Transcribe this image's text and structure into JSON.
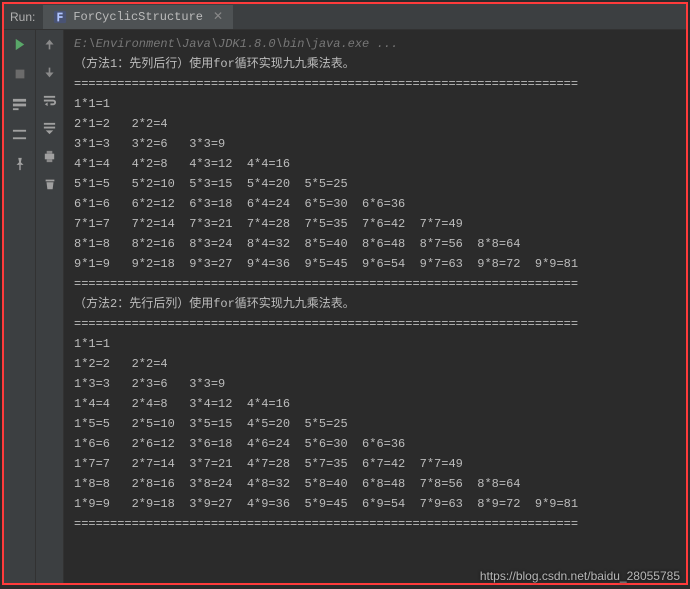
{
  "header": {
    "run_label": "Run:",
    "tab_name": "ForCyclicStructure"
  },
  "command": "E:\\Environment\\Java\\JDK1.8.0\\bin\\java.exe ...",
  "console_lines": [
    "（方法1：先列后行）使用for循环实现九九乘法表。",
    "======================================================================",
    "1*1=1",
    "2*1=2   2*2=4",
    "3*1=3   3*2=6   3*3=9",
    "4*1=4   4*2=8   4*3=12  4*4=16",
    "5*1=5   5*2=10  5*3=15  5*4=20  5*5=25",
    "6*1=6   6*2=12  6*3=18  6*4=24  6*5=30  6*6=36",
    "7*1=7   7*2=14  7*3=21  7*4=28  7*5=35  7*6=42  7*7=49",
    "8*1=8   8*2=16  8*3=24  8*4=32  8*5=40  8*6=48  8*7=56  8*8=64",
    "9*1=9   9*2=18  9*3=27  9*4=36  9*5=45  9*6=54  9*7=63  9*8=72  9*9=81",
    "======================================================================",
    "（方法2：先行后列）使用for循环实现九九乘法表。",
    "======================================================================",
    "1*1=1",
    "1*2=2   2*2=4",
    "1*3=3   2*3=6   3*3=9",
    "1*4=4   2*4=8   3*4=12  4*4=16",
    "1*5=5   2*5=10  3*5=15  4*5=20  5*5=25",
    "1*6=6   2*6=12  3*6=18  4*6=24  5*6=30  6*6=36",
    "1*7=7   2*7=14  3*7=21  4*7=28  5*7=35  6*7=42  7*7=49",
    "1*8=8   2*8=16  3*8=24  4*8=32  5*8=40  6*8=48  7*8=56  8*8=64",
    "1*9=9   2*9=18  3*9=27  4*9=36  5*9=45  6*9=54  7*9=63  8*9=72  9*9=81",
    "======================================================================"
  ],
  "watermark": "https://blog.csdn.net/baidu_28055785"
}
